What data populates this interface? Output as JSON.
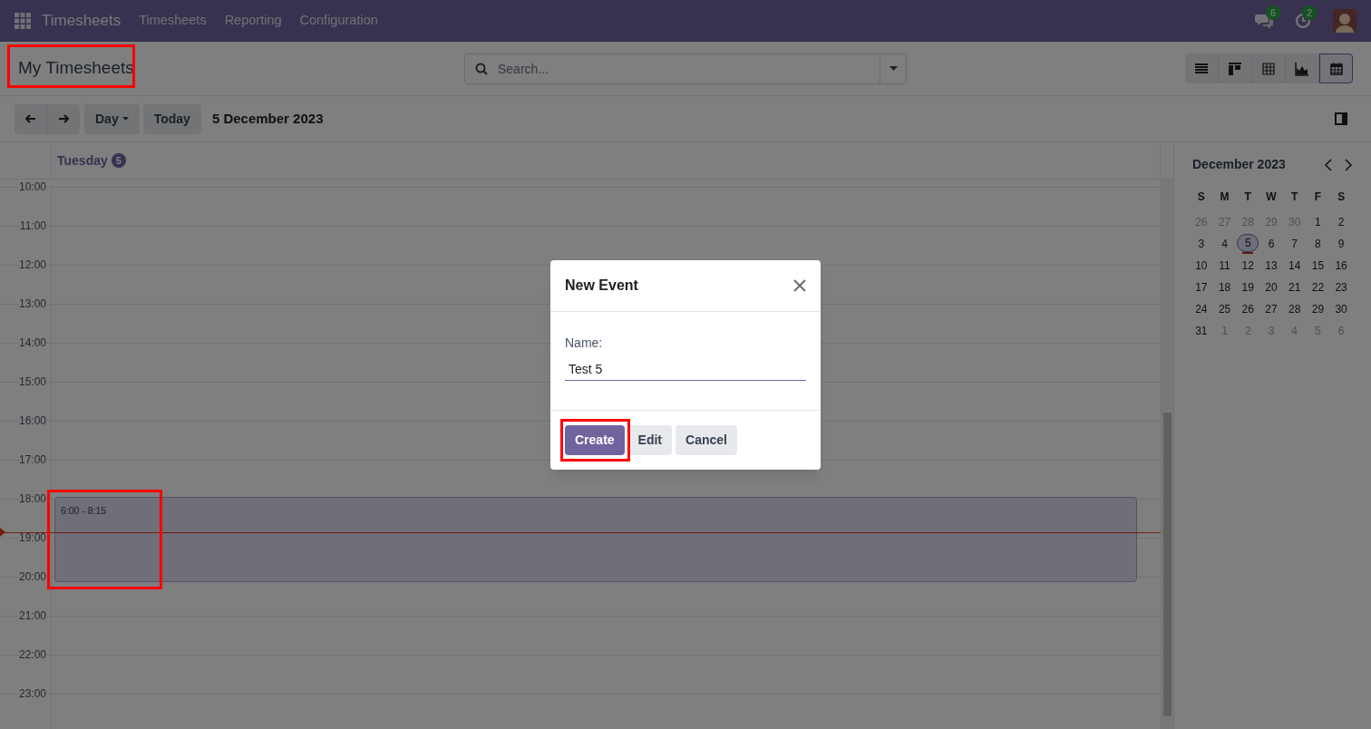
{
  "navbar": {
    "app_name": "Timesheets",
    "menus": [
      "Timesheets",
      "Reporting",
      "Configuration"
    ],
    "messages_badge": "6",
    "activities_badge": "2"
  },
  "control_panel": {
    "title": "My Timesheets",
    "title_highlighted": true,
    "search": {
      "placeholder": "Search..."
    },
    "views": [
      {
        "kind": "list",
        "selected": false
      },
      {
        "kind": "kanban",
        "selected": false
      },
      {
        "kind": "pivot",
        "selected": false
      },
      {
        "kind": "graph",
        "selected": false
      },
      {
        "kind": "calendar",
        "selected": true
      }
    ]
  },
  "toolbar": {
    "scale": "Day",
    "today": "Today",
    "date": "5 December 2023"
  },
  "day_header": {
    "weekday": "Tuesday",
    "day": "5"
  },
  "hours": [
    "10:00",
    "11:00",
    "12:00",
    "13:00",
    "14:00",
    "15:00",
    "16:00",
    "17:00",
    "18:00",
    "19:00",
    "20:00",
    "21:00",
    "22:00",
    "23:00"
  ],
  "events": [
    {
      "time": "6:00 - 8:15",
      "highlighted": true
    }
  ],
  "mini_calendar": {
    "month": "December 2023",
    "weekdays": [
      "S",
      "M",
      "T",
      "W",
      "T",
      "F",
      "S"
    ],
    "weeks": [
      [
        {
          "d": "26",
          "outside": true,
          "selected": false,
          "today": false
        },
        {
          "d": "27",
          "outside": true,
          "selected": false,
          "today": false
        },
        {
          "d": "28",
          "outside": true,
          "selected": false,
          "today": false
        },
        {
          "d": "29",
          "outside": true,
          "selected": false,
          "today": false
        },
        {
          "d": "30",
          "outside": true,
          "selected": false,
          "today": false
        },
        {
          "d": "1",
          "outside": false,
          "selected": false,
          "today": false
        },
        {
          "d": "2",
          "outside": false,
          "selected": false,
          "today": false
        }
      ],
      [
        {
          "d": "3",
          "outside": false,
          "selected": false,
          "today": false
        },
        {
          "d": "4",
          "outside": false,
          "selected": false,
          "today": false
        },
        {
          "d": "5",
          "outside": false,
          "selected": true,
          "today": true
        },
        {
          "d": "6",
          "outside": false,
          "selected": false,
          "today": false
        },
        {
          "d": "7",
          "outside": false,
          "selected": false,
          "today": false
        },
        {
          "d": "8",
          "outside": false,
          "selected": false,
          "today": false
        },
        {
          "d": "9",
          "outside": false,
          "selected": false,
          "today": false
        }
      ],
      [
        {
          "d": "10",
          "outside": false,
          "selected": false,
          "today": false
        },
        {
          "d": "11",
          "outside": false,
          "selected": false,
          "today": false
        },
        {
          "d": "12",
          "outside": false,
          "selected": false,
          "today": false
        },
        {
          "d": "13",
          "outside": false,
          "selected": false,
          "today": false
        },
        {
          "d": "14",
          "outside": false,
          "selected": false,
          "today": false
        },
        {
          "d": "15",
          "outside": false,
          "selected": false,
          "today": false
        },
        {
          "d": "16",
          "outside": false,
          "selected": false,
          "today": false
        }
      ],
      [
        {
          "d": "17",
          "outside": false,
          "selected": false,
          "today": false
        },
        {
          "d": "18",
          "outside": false,
          "selected": false,
          "today": false
        },
        {
          "d": "19",
          "outside": false,
          "selected": false,
          "today": false
        },
        {
          "d": "20",
          "outside": false,
          "selected": false,
          "today": false
        },
        {
          "d": "21",
          "outside": false,
          "selected": false,
          "today": false
        },
        {
          "d": "22",
          "outside": false,
          "selected": false,
          "today": false
        },
        {
          "d": "23",
          "outside": false,
          "selected": false,
          "today": false
        }
      ],
      [
        {
          "d": "24",
          "outside": false,
          "selected": false,
          "today": false
        },
        {
          "d": "25",
          "outside": false,
          "selected": false,
          "today": false
        },
        {
          "d": "26",
          "outside": false,
          "selected": false,
          "today": false
        },
        {
          "d": "27",
          "outside": false,
          "selected": false,
          "today": false
        },
        {
          "d": "28",
          "outside": false,
          "selected": false,
          "today": false
        },
        {
          "d": "29",
          "outside": false,
          "selected": false,
          "today": false
        },
        {
          "d": "30",
          "outside": false,
          "selected": false,
          "today": false
        }
      ],
      [
        {
          "d": "31",
          "outside": false,
          "selected": false,
          "today": false
        },
        {
          "d": "1",
          "outside": true,
          "selected": false,
          "today": false
        },
        {
          "d": "2",
          "outside": true,
          "selected": false,
          "today": false
        },
        {
          "d": "3",
          "outside": true,
          "selected": false,
          "today": false
        },
        {
          "d": "4",
          "outside": true,
          "selected": false,
          "today": false
        },
        {
          "d": "5",
          "outside": true,
          "selected": false,
          "today": false
        },
        {
          "d": "6",
          "outside": true,
          "selected": false,
          "today": false
        }
      ]
    ]
  },
  "dialog": {
    "title": "New Event",
    "field_label": "Name:",
    "field_value": "Test 5",
    "buttons": [
      {
        "label": "Create",
        "kind": "primary",
        "highlighted": true
      },
      {
        "label": "Edit",
        "kind": "secondary",
        "highlighted": false
      },
      {
        "label": "Cancel",
        "kind": "secondary",
        "highlighted": false
      }
    ]
  }
}
